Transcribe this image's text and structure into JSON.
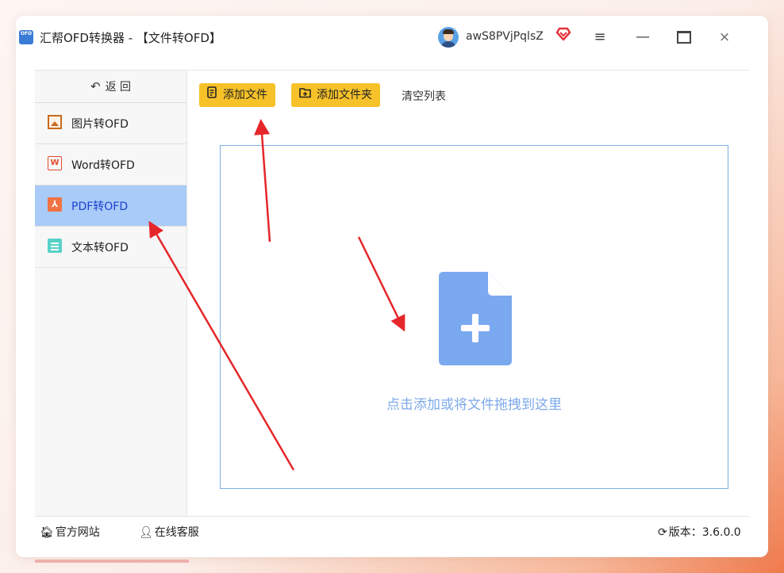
{
  "window": {
    "logo_text": "OFD",
    "title": "汇帮OFD转换器 - 【文件转OFD】",
    "username": "awS8PVjPqlsZ",
    "close_glyph": "×"
  },
  "sidebar": {
    "back_label": "返  回",
    "items": [
      {
        "label": "图片转OFD",
        "icon": "image-icon"
      },
      {
        "label": "Word转OFD",
        "icon": "word-icon"
      },
      {
        "label": "PDF转OFD",
        "icon": "pdf-icon",
        "active": true
      },
      {
        "label": "文本转OFD",
        "icon": "text-file-icon"
      }
    ]
  },
  "toolbar": {
    "add_file_label": "添加文件",
    "add_folder_label": "添加文件夹",
    "clear_label": "清空列表"
  },
  "drop_zone": {
    "hint": "点击添加或将文件拖拽到这里"
  },
  "footer": {
    "website_label": "官方网站",
    "service_label": "在线客服",
    "version_label": "版本：3.6.0.0"
  },
  "colors": {
    "accent_yellow": "#f7c229",
    "active_item_bg": "#a9cbf7",
    "active_item_text": "#1a3fd0",
    "drop_icon_blue": "#7ba9ef",
    "annotation_arrow": "#e5262a"
  }
}
